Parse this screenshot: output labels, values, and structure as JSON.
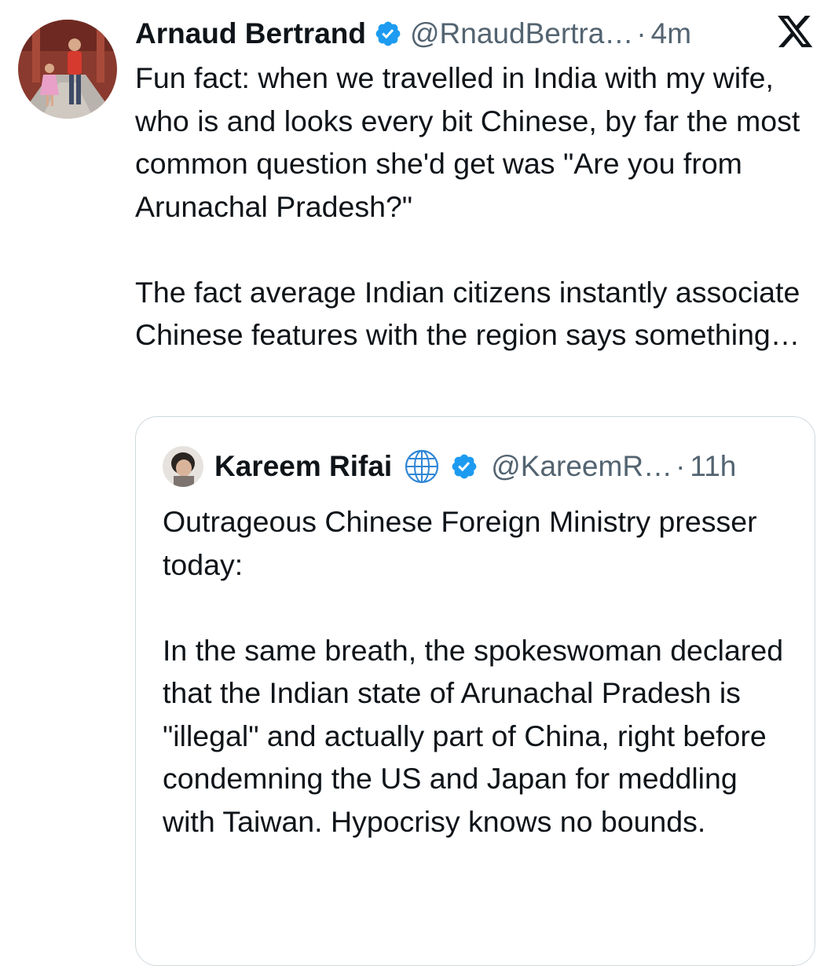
{
  "tweet": {
    "author": {
      "name": "Arnaud Bertrand",
      "handle": "@RnaudBertra…",
      "separator": "·",
      "time": "4m",
      "verified": true
    },
    "platform_icon": "x-logo-icon",
    "paragraphs": [
      "Fun fact: when we travelled in India with my wife, who is and looks every bit Chinese, by far the most common question she'd get was \"Are you from Arunachal Pradesh?\"",
      "The fact average Indian citizens instantly associate Chinese features with the region says something…"
    ]
  },
  "quoted_tweet": {
    "author": {
      "name": "Kareem Rifai",
      "name_emoji": "globe-icon",
      "handle": "@KareemR…",
      "separator": "·",
      "time": "11h",
      "verified": true
    },
    "paragraphs": [
      "Outrageous Chinese Foreign Ministry presser today:",
      "In the same breath, the spokeswoman declared that the Indian state of Arunachal Pradesh is \"illegal\" and actually part of China, right before condemning the US and Japan for meddling with Taiwan. Hypocrisy knows no bounds."
    ]
  },
  "colors": {
    "text_primary": "#0f1419",
    "text_secondary": "#536471",
    "verified_blue": "#1d9bf0",
    "border": "#cfd9de"
  }
}
